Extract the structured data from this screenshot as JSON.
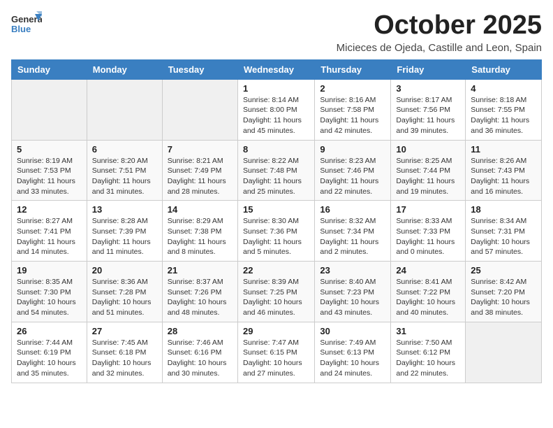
{
  "logo": {
    "line1": "General",
    "line2": "Blue"
  },
  "title": "October 2025",
  "location": "Micieces de Ojeda, Castille and Leon, Spain",
  "headers": [
    "Sunday",
    "Monday",
    "Tuesday",
    "Wednesday",
    "Thursday",
    "Friday",
    "Saturday"
  ],
  "weeks": [
    [
      {
        "date": "",
        "text": ""
      },
      {
        "date": "",
        "text": ""
      },
      {
        "date": "",
        "text": ""
      },
      {
        "date": "1",
        "text": "Sunrise: 8:14 AM\nSunset: 8:00 PM\nDaylight: 11 hours and 45 minutes."
      },
      {
        "date": "2",
        "text": "Sunrise: 8:16 AM\nSunset: 7:58 PM\nDaylight: 11 hours and 42 minutes."
      },
      {
        "date": "3",
        "text": "Sunrise: 8:17 AM\nSunset: 7:56 PM\nDaylight: 11 hours and 39 minutes."
      },
      {
        "date": "4",
        "text": "Sunrise: 8:18 AM\nSunset: 7:55 PM\nDaylight: 11 hours and 36 minutes."
      }
    ],
    [
      {
        "date": "5",
        "text": "Sunrise: 8:19 AM\nSunset: 7:53 PM\nDaylight: 11 hours and 33 minutes."
      },
      {
        "date": "6",
        "text": "Sunrise: 8:20 AM\nSunset: 7:51 PM\nDaylight: 11 hours and 31 minutes."
      },
      {
        "date": "7",
        "text": "Sunrise: 8:21 AM\nSunset: 7:49 PM\nDaylight: 11 hours and 28 minutes."
      },
      {
        "date": "8",
        "text": "Sunrise: 8:22 AM\nSunset: 7:48 PM\nDaylight: 11 hours and 25 minutes."
      },
      {
        "date": "9",
        "text": "Sunrise: 8:23 AM\nSunset: 7:46 PM\nDaylight: 11 hours and 22 minutes."
      },
      {
        "date": "10",
        "text": "Sunrise: 8:25 AM\nSunset: 7:44 PM\nDaylight: 11 hours and 19 minutes."
      },
      {
        "date": "11",
        "text": "Sunrise: 8:26 AM\nSunset: 7:43 PM\nDaylight: 11 hours and 16 minutes."
      }
    ],
    [
      {
        "date": "12",
        "text": "Sunrise: 8:27 AM\nSunset: 7:41 PM\nDaylight: 11 hours and 14 minutes."
      },
      {
        "date": "13",
        "text": "Sunrise: 8:28 AM\nSunset: 7:39 PM\nDaylight: 11 hours and 11 minutes."
      },
      {
        "date": "14",
        "text": "Sunrise: 8:29 AM\nSunset: 7:38 PM\nDaylight: 11 hours and 8 minutes."
      },
      {
        "date": "15",
        "text": "Sunrise: 8:30 AM\nSunset: 7:36 PM\nDaylight: 11 hours and 5 minutes."
      },
      {
        "date": "16",
        "text": "Sunrise: 8:32 AM\nSunset: 7:34 PM\nDaylight: 11 hours and 2 minutes."
      },
      {
        "date": "17",
        "text": "Sunrise: 8:33 AM\nSunset: 7:33 PM\nDaylight: 11 hours and 0 minutes."
      },
      {
        "date": "18",
        "text": "Sunrise: 8:34 AM\nSunset: 7:31 PM\nDaylight: 10 hours and 57 minutes."
      }
    ],
    [
      {
        "date": "19",
        "text": "Sunrise: 8:35 AM\nSunset: 7:30 PM\nDaylight: 10 hours and 54 minutes."
      },
      {
        "date": "20",
        "text": "Sunrise: 8:36 AM\nSunset: 7:28 PM\nDaylight: 10 hours and 51 minutes."
      },
      {
        "date": "21",
        "text": "Sunrise: 8:37 AM\nSunset: 7:26 PM\nDaylight: 10 hours and 48 minutes."
      },
      {
        "date": "22",
        "text": "Sunrise: 8:39 AM\nSunset: 7:25 PM\nDaylight: 10 hours and 46 minutes."
      },
      {
        "date": "23",
        "text": "Sunrise: 8:40 AM\nSunset: 7:23 PM\nDaylight: 10 hours and 43 minutes."
      },
      {
        "date": "24",
        "text": "Sunrise: 8:41 AM\nSunset: 7:22 PM\nDaylight: 10 hours and 40 minutes."
      },
      {
        "date": "25",
        "text": "Sunrise: 8:42 AM\nSunset: 7:20 PM\nDaylight: 10 hours and 38 minutes."
      }
    ],
    [
      {
        "date": "26",
        "text": "Sunrise: 7:44 AM\nSunset: 6:19 PM\nDaylight: 10 hours and 35 minutes."
      },
      {
        "date": "27",
        "text": "Sunrise: 7:45 AM\nSunset: 6:18 PM\nDaylight: 10 hours and 32 minutes."
      },
      {
        "date": "28",
        "text": "Sunrise: 7:46 AM\nSunset: 6:16 PM\nDaylight: 10 hours and 30 minutes."
      },
      {
        "date": "29",
        "text": "Sunrise: 7:47 AM\nSunset: 6:15 PM\nDaylight: 10 hours and 27 minutes."
      },
      {
        "date": "30",
        "text": "Sunrise: 7:49 AM\nSunset: 6:13 PM\nDaylight: 10 hours and 24 minutes."
      },
      {
        "date": "31",
        "text": "Sunrise: 7:50 AM\nSunset: 6:12 PM\nDaylight: 10 hours and 22 minutes."
      },
      {
        "date": "",
        "text": ""
      }
    ]
  ]
}
